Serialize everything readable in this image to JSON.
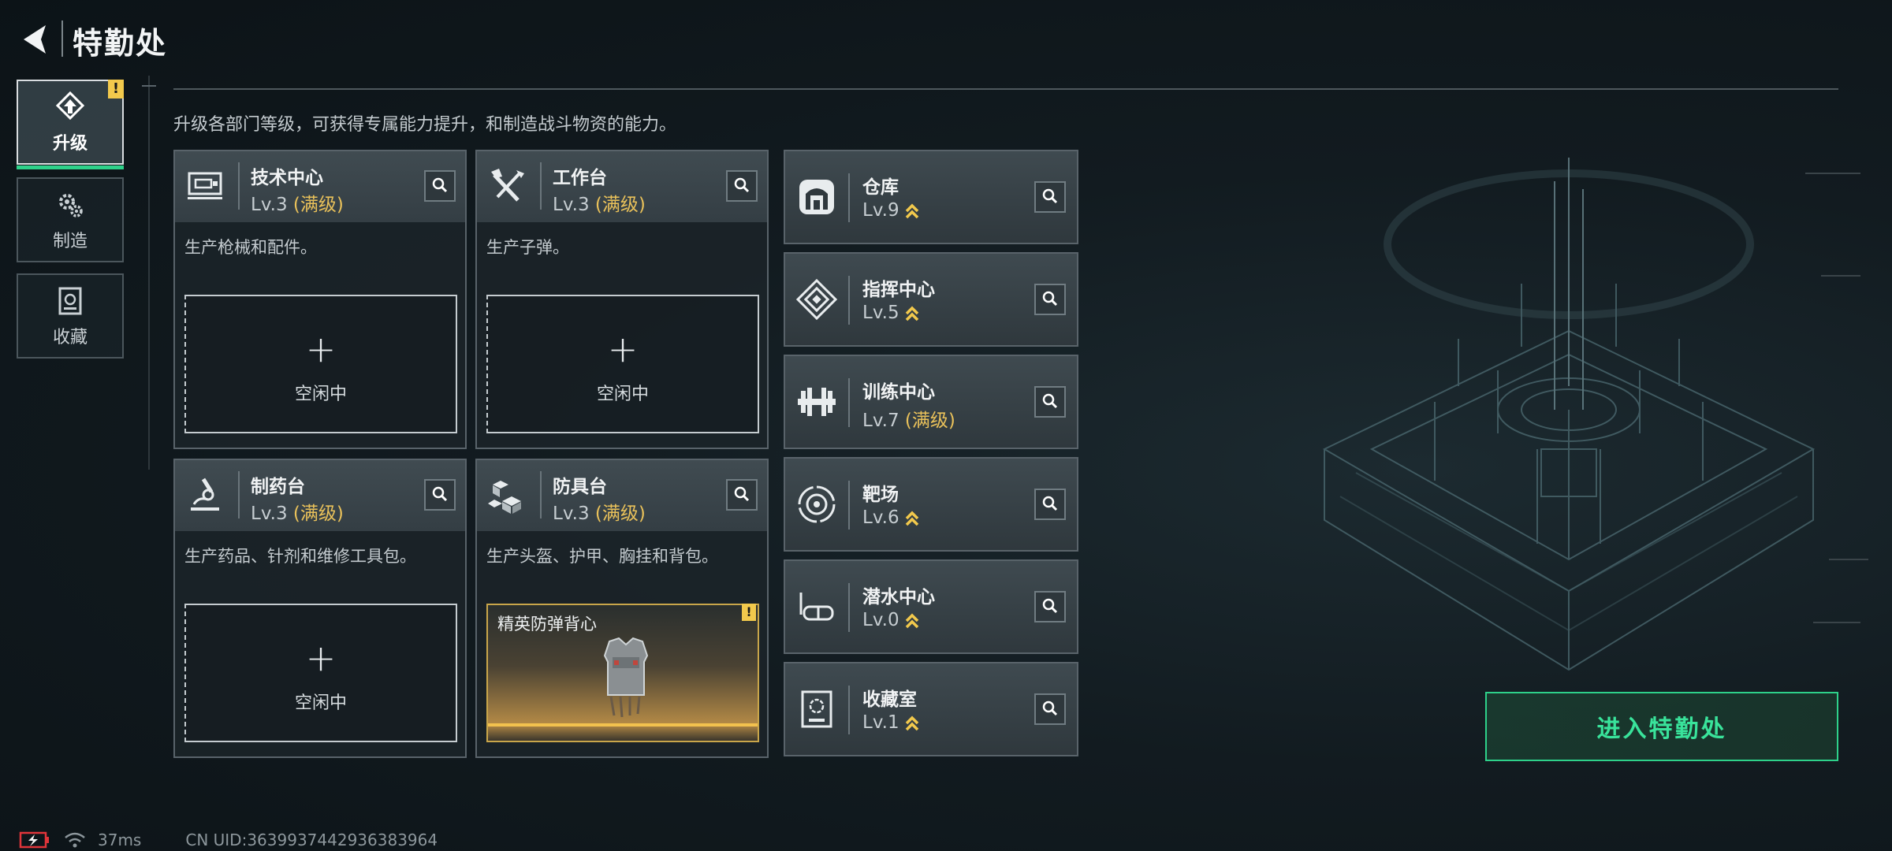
{
  "header": {
    "title": "特勤处"
  },
  "nav": [
    {
      "label": "升级",
      "icon": "upgrade-icon",
      "active": true,
      "badge": "!"
    },
    {
      "label": "制造",
      "icon": "gears-icon",
      "active": false
    },
    {
      "label": "收藏",
      "icon": "collection-icon",
      "active": false
    }
  ],
  "description": "升级各部门等级，可获得专属能力提升，和制造战斗物资的能力。",
  "workshops": [
    {
      "name": "技术中心",
      "level": "Lv.3",
      "max_tag": "(满级)",
      "desc": "生产枪械和配件。",
      "icon": "monitor-icon",
      "slot": {
        "plus": "+",
        "label": "空闲中"
      }
    },
    {
      "name": "工作台",
      "level": "Lv.3",
      "max_tag": "(满级)",
      "desc": "生产子弹。",
      "icon": "tools-icon",
      "slot": {
        "plus": "+",
        "label": "空闲中"
      }
    },
    {
      "name": "制药台",
      "level": "Lv.3",
      "max_tag": "(满级)",
      "desc": "生产药品、针剂和维修工具包。",
      "icon": "microscope-icon",
      "slot": {
        "plus": "+",
        "label": "空闲中"
      }
    },
    {
      "name": "防具台",
      "level": "Lv.3",
      "max_tag": "(满级)",
      "desc": "生产头盔、护甲、胸挂和背包。",
      "icon": "armor-blocks-icon",
      "slot": {
        "item_name": "精英防弹背心",
        "badge": "!"
      }
    }
  ],
  "facilities": [
    {
      "name": "仓库",
      "level": "Lv.9",
      "max_tag": "",
      "icon": "warehouse-icon",
      "upgradable": true
    },
    {
      "name": "指挥中心",
      "level": "Lv.5",
      "max_tag": "",
      "icon": "command-chip-icon",
      "upgradable": true
    },
    {
      "name": "训练中心",
      "level": "Lv.7",
      "max_tag": "(满级)",
      "icon": "dumbbell-icon",
      "upgradable": false
    },
    {
      "name": "靶场",
      "level": "Lv.6",
      "max_tag": "",
      "icon": "target-icon",
      "upgradable": true
    },
    {
      "name": "潜水中心",
      "level": "Lv.0",
      "max_tag": "",
      "icon": "diving-mask-icon",
      "upgradable": true
    },
    {
      "name": "收藏室",
      "level": "Lv.1",
      "max_tag": "",
      "icon": "collection-room-icon",
      "upgradable": true
    }
  ],
  "enter_button": {
    "label": "进入特勤处"
  },
  "status": {
    "ping": "37ms",
    "uid": "CN UID:3639937442936383964"
  },
  "colors": {
    "accent_green": "#2ed18a",
    "max_level_gold": "#e9c15a",
    "upgrade_chevron": "#f2c94c",
    "warning_badge": "#f2c94c"
  }
}
